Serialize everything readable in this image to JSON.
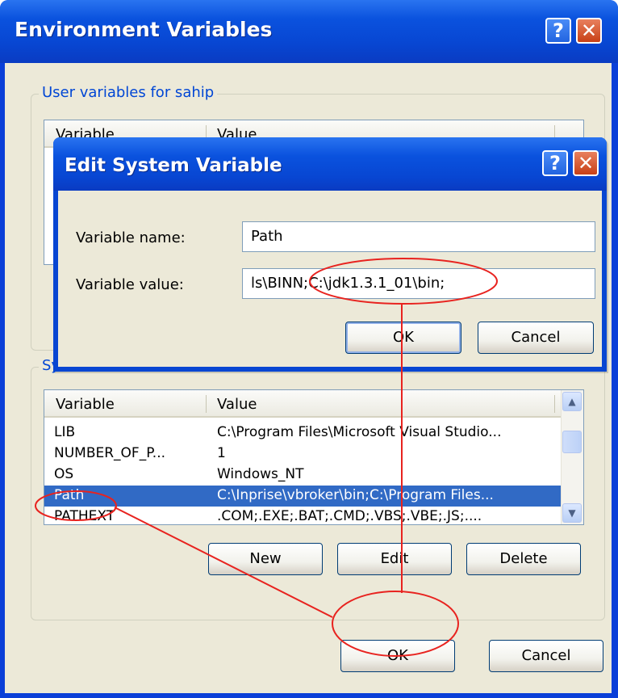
{
  "env_window": {
    "title": "Environment Variables",
    "help_glyph": "?",
    "close_glyph": "✕",
    "user_group": {
      "label": "User variables for sahip",
      "columns": [
        "Variable",
        "Value"
      ]
    },
    "system_group": {
      "label": "Sy",
      "columns": [
        "Variable",
        "Value"
      ],
      "rows": [
        {
          "variable": "LIB",
          "value": "C:\\Program Files\\Microsoft Visual Studio..."
        },
        {
          "variable": "NUMBER_OF_P...",
          "value": "1"
        },
        {
          "variable": "OS",
          "value": "Windows_NT"
        },
        {
          "variable": "Path",
          "value": "C:\\Inprise\\vbroker\\bin;C:\\Program Files...",
          "selected": true
        },
        {
          "variable": "PATHEXT",
          "value": ".COM;.EXE;.BAT;.CMD;.VBS;.VBE;.JS;...."
        }
      ],
      "buttons": {
        "new": "New",
        "edit": "Edit",
        "delete": "Delete"
      }
    },
    "buttons": {
      "ok": "OK",
      "cancel": "Cancel"
    }
  },
  "edit_dialog": {
    "title": "Edit System Variable",
    "help_glyph": "?",
    "close_glyph": "✕",
    "name_label": "Variable name:",
    "name_value": "Path",
    "value_label": "Variable value:",
    "value_value": "ls\\BINN;C:\\jdk1.3.1_01\\bin;",
    "buttons": {
      "ok": "OK",
      "cancel": "Cancel"
    }
  },
  "colors": {
    "titlebar": "#0a52de",
    "selection": "#316ac5",
    "annotation": "#e8231f",
    "face": "#ece9d8"
  }
}
